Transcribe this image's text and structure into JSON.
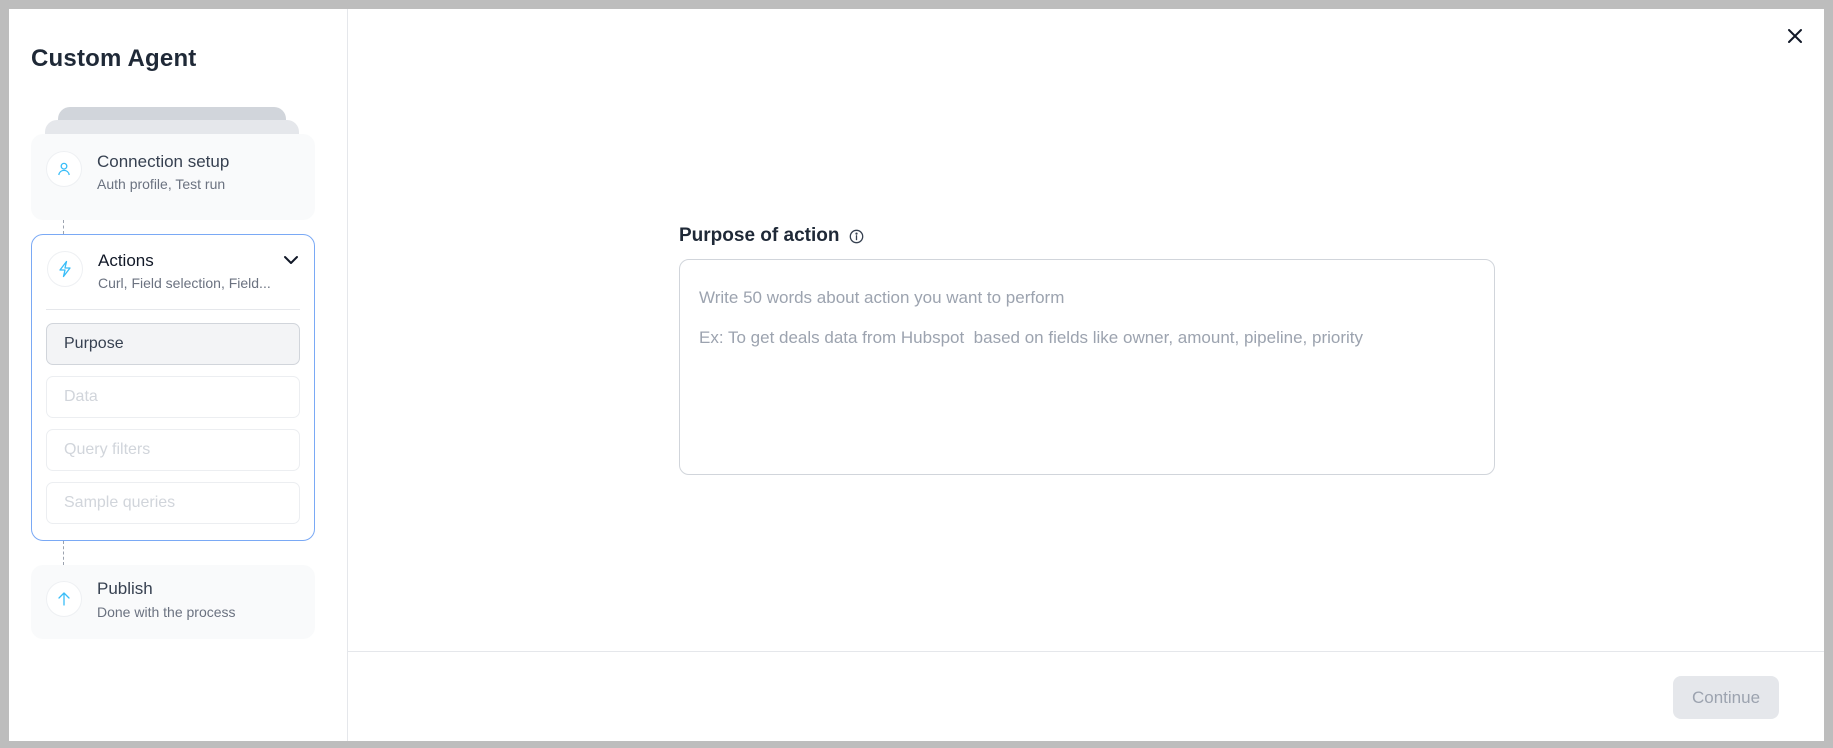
{
  "sidebar": {
    "title": "Custom Agent",
    "steps": [
      {
        "title": "Connection setup",
        "subtitle": "Auth profile, Test run",
        "icon": "user-icon"
      },
      {
        "title": "Actions",
        "subtitle": "Curl, Field selection, Field...",
        "icon": "lightning-icon"
      },
      {
        "title": "Publish",
        "subtitle": "Done with the process",
        "icon": "arrow-up-icon"
      }
    ],
    "sub_items": [
      "Purpose",
      "Data",
      "Query filters",
      "Sample queries"
    ]
  },
  "main": {
    "field_label": "Purpose of action",
    "placeholder_line1": "Write 50 words about action you want to perform",
    "placeholder_line2": "Ex: To get deals data from Hubspot  based on fields like owner, amount, pipeline, priority"
  },
  "footer": {
    "continue_label": "Continue"
  },
  "colors": {
    "accent": "#7aa9f5",
    "icon_blue": "#38bdf8",
    "disabled_bg": "#e5e7eb"
  }
}
